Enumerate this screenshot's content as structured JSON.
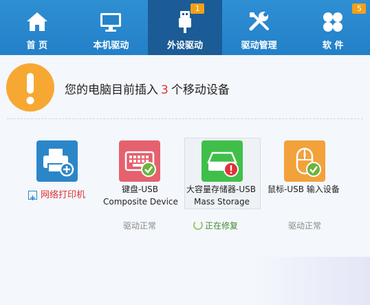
{
  "tabs": [
    {
      "label": "首 页",
      "icon": "home-icon"
    },
    {
      "label": "本机驱动",
      "icon": "monitor-icon"
    },
    {
      "label": "外设驱动",
      "icon": "usb-icon",
      "badge": "1",
      "active": true
    },
    {
      "label": "驱动管理",
      "icon": "tools-icon"
    },
    {
      "label": "软 件",
      "icon": "apps-icon",
      "badge": "5"
    }
  ],
  "notice": {
    "prefix": "您的电脑目前插入",
    "count": "3",
    "suffix": "个移动设备"
  },
  "devices": [
    {
      "name_line1": "网络打印机",
      "icon": "printer-icon",
      "color": "#2b86c8",
      "status": ""
    },
    {
      "name_line1": "键盘-USB",
      "name_line2": "Composite Device",
      "icon": "keyboard-icon",
      "color": "#e5616d",
      "status": "驱动正常"
    },
    {
      "name_line1": "大容量存储器-USB",
      "name_line2": "Mass Storage",
      "icon": "storage-icon",
      "color": "#3fbf4a",
      "status": "正在修复"
    },
    {
      "name_line1": "鼠标-USB 输入设备",
      "icon": "mouse-icon",
      "color": "#f3a13b",
      "status": "驱动正常"
    }
  ],
  "colors": {
    "topbar": "#2683c9",
    "active_tab": "#1b5c96",
    "badge": "#f2a018",
    "warn": "#f7a833",
    "ok": "#6db33f",
    "error": "#e0313b"
  }
}
